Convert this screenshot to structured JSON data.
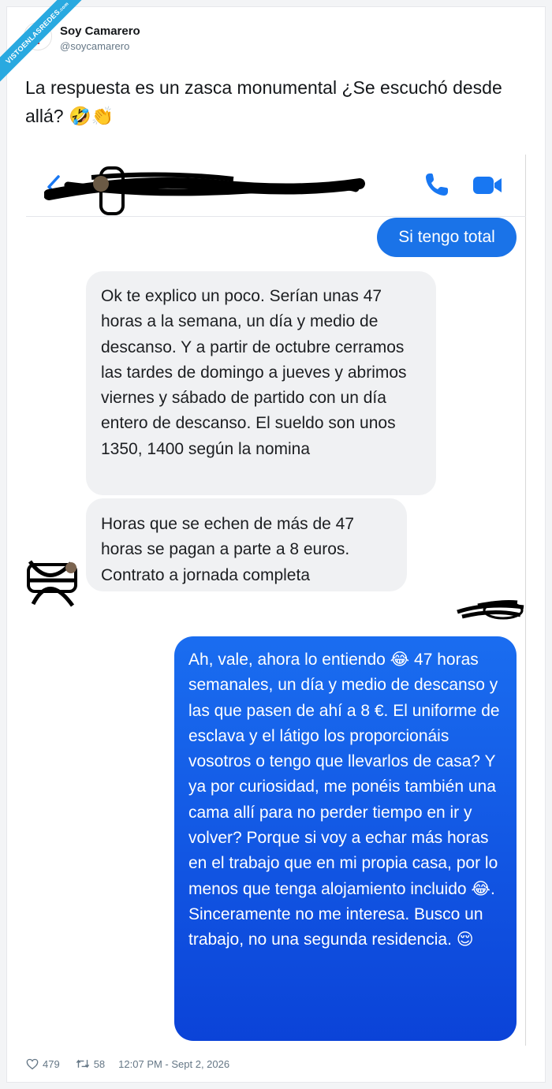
{
  "watermark": {
    "line1": "VISTOENLASREDES",
    "line2": ".com"
  },
  "tweet": {
    "author_name": "Soy Camarero",
    "author_handle": "@soycamarero",
    "text": "La respuesta es un zasca monumental ¿Se escuchó desde allá? 🤣👏"
  },
  "chat": {
    "colors": {
      "accent": "#1a73e8",
      "incoming_bg": "#f0f1f3"
    },
    "messages": [
      {
        "dir": "out",
        "text": "Si tengo total"
      },
      {
        "dir": "in",
        "text": "Ok te explico un poco. Serían unas 47 horas a la semana, un día  y medio de descanso. Y a partir de octubre cerramos las tardes de domingo a jueves y abrimos viernes y sábado de partido con un día entero de descanso. El sueldo son unos 1350, 1400 según la nomina"
      },
      {
        "dir": "in",
        "text": "Horas que se echen de más de 47 horas se pagan a parte a 8 euros. Contrato a jornada completa"
      },
      {
        "dir": "out",
        "text": "Ah, vale, ahora lo entiendo 😂 47 horas semanales, un día y medio de descanso y las que pasen de ahí a 8 €. El uniforme de esclava y el látigo los proporcionáis vosotros o tengo que llevarlos de casa? Y ya por curiosidad, me ponéis también una cama allí para no perder tiempo en ir y volver? Porque si voy a echar más horas en el trabajo que en mi propia casa, por lo menos que tenga alojamiento incluido 😂. Sinceramente no me interesa. Busco un trabajo, no una segunda residencia. 😌"
      }
    ]
  },
  "footer": {
    "likes": "479",
    "retweets": "58",
    "timestamp": "12:07 PM - Sept 2, 2026"
  },
  "icons": [
    "heart-icon",
    "retweet-icon",
    "back-arrow-icon",
    "phone-icon",
    "video-camera-icon"
  ]
}
